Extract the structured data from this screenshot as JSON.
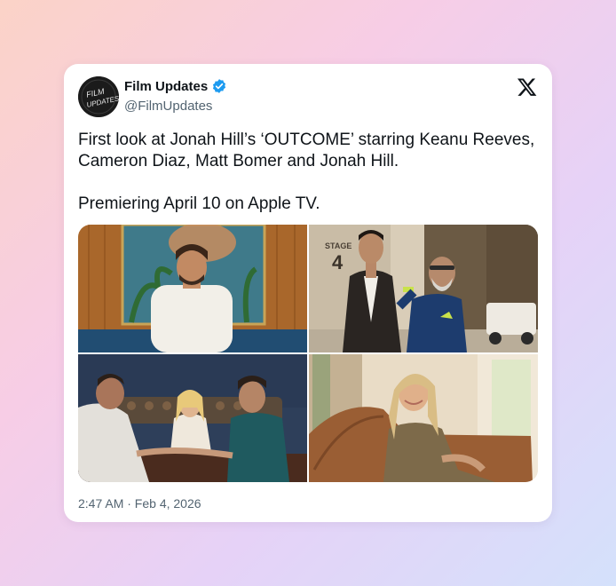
{
  "author": {
    "display_name": "Film Updates",
    "handle": "@FilmUpdates",
    "avatar_text": "FILM UPDATES",
    "verified_icon": "verified-badge-icon",
    "verified_color": "#1d9bf0"
  },
  "platform_icon": "x-logo-icon",
  "tweet": {
    "text": "First look at Jonah Hill’s ‘OUTCOME’ starring Keanu Reeves, Cameron Diaz, Matt Bomer and Jonah Hill.\n\nPremiering April 10 on Apple TV.",
    "timestamp": "2:47 AM · Feb 4, 2026"
  },
  "media": {
    "stage_sign": "STAGE",
    "stage_number": "4",
    "photos": [
      "man-in-white-tee-photo",
      "two-men-on-studio-lot-photo",
      "three-people-on-sofa-photo",
      "woman-on-leather-sofa-photo"
    ]
  },
  "colors": {
    "text": "#0f1419",
    "secondary_text": "#536471",
    "card": "#ffffff"
  }
}
